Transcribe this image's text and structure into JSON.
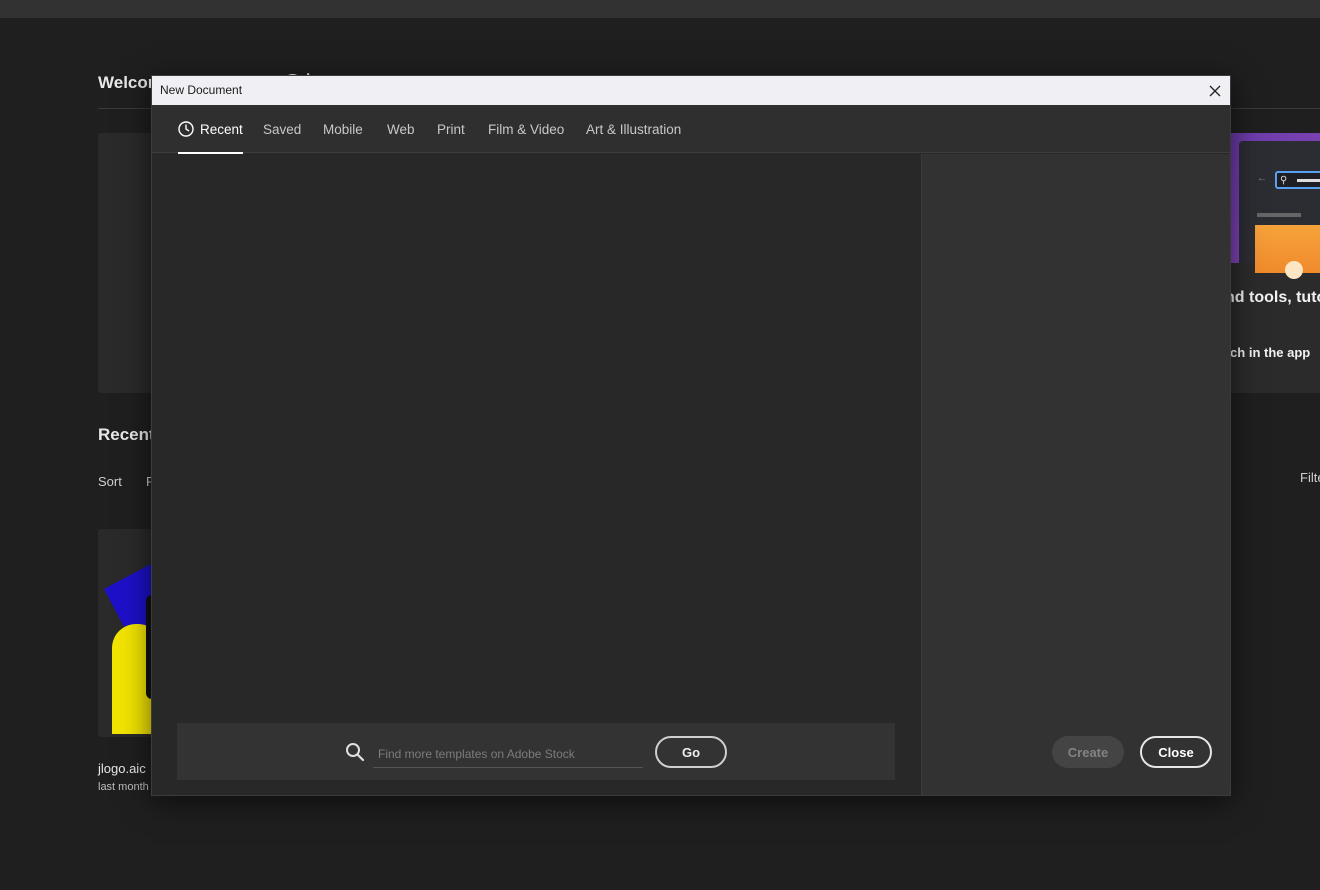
{
  "background": {
    "welcome_title": "Welcome to Illustrator, 은후",
    "recent_heading": "Recent",
    "sort_label": "Sort",
    "sort_value": "R",
    "filter_label": "Filter",
    "promo_text_1": "nd tools, tuto",
    "promo_text_2": "rch in the app",
    "recent_file": {
      "name": "jlogo.aic",
      "date": "last month"
    }
  },
  "dialog": {
    "title": "New Document",
    "tabs": [
      {
        "label": "Recent",
        "active": true
      },
      {
        "label": "Saved"
      },
      {
        "label": "Mobile"
      },
      {
        "label": "Web"
      },
      {
        "label": "Print"
      },
      {
        "label": "Film & Video"
      },
      {
        "label": "Art & Illustration"
      }
    ],
    "stock_search": {
      "placeholder": "Find more templates on Adobe Stock",
      "go_label": "Go"
    },
    "create_label": "Create",
    "close_label": "Close"
  },
  "colors": {
    "dialog_bg": "#282828",
    "panel_bg": "#323232",
    "titlebar_bg": "#f0f0f4",
    "accent_white": "#ffffff"
  }
}
